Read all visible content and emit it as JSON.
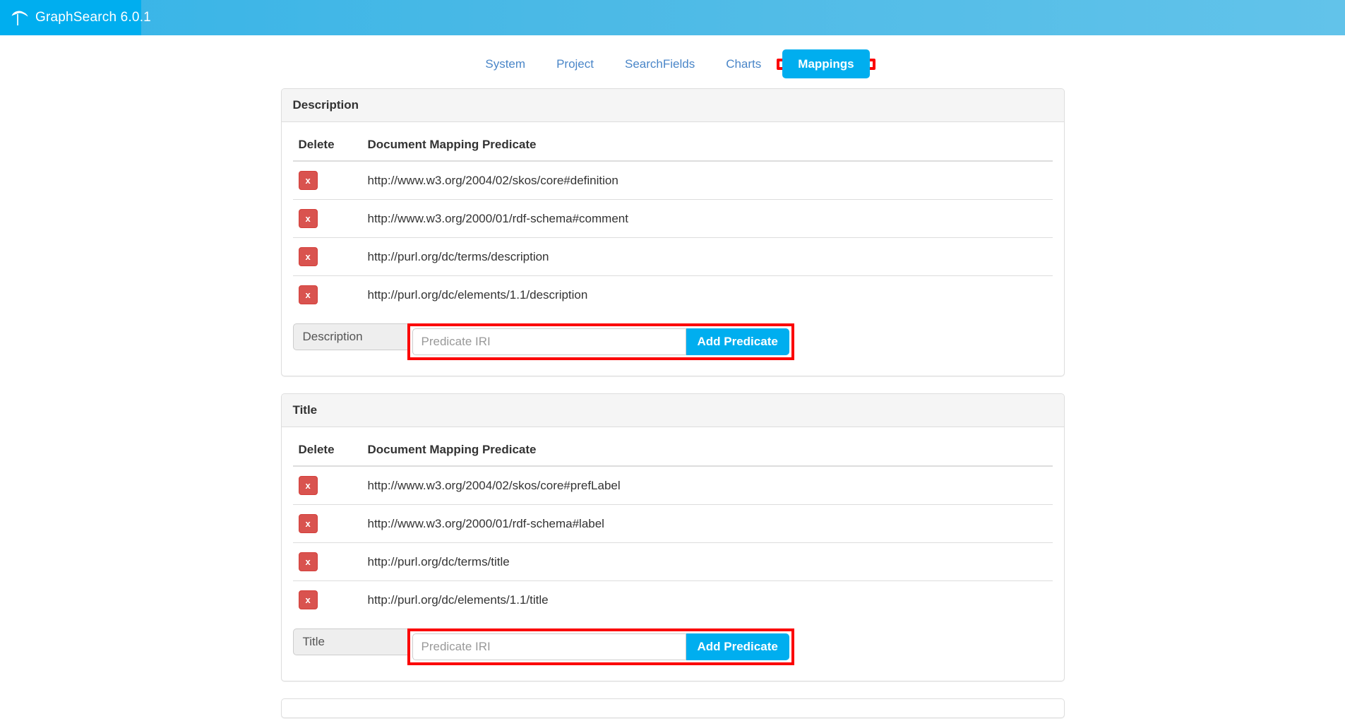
{
  "header": {
    "brand_title": "GraphSearch 6.0.1",
    "logo_icon": "umbrella-icon",
    "brand_color": "#00aeef",
    "bar_color": "#4ab9e6"
  },
  "nav": {
    "tabs": [
      {
        "label": "System",
        "active": false
      },
      {
        "label": "Project",
        "active": false
      },
      {
        "label": "SearchFields",
        "active": false
      },
      {
        "label": "Charts",
        "active": false
      },
      {
        "label": "Mappings",
        "active": true
      }
    ],
    "active_tab": "Mappings",
    "highlight_color": "#fb0000",
    "active_bg": "#00aeef",
    "link_color": "#4a86c8"
  },
  "panels": [
    {
      "heading": "Description",
      "columns": [
        "Delete",
        "Document Mapping Predicate"
      ],
      "delete_label": "x",
      "rows": [
        {
          "predicate": "http://www.w3.org/2004/02/skos/core#definition"
        },
        {
          "predicate": "http://www.w3.org/2000/01/rdf-schema#comment"
        },
        {
          "predicate": "http://purl.org/dc/terms/description"
        },
        {
          "predicate": "http://purl.org/dc/elements/1.1/description"
        }
      ],
      "add_form": {
        "addon_label": "Description",
        "input_value": "",
        "input_placeholder": "Predicate IRI",
        "button_label": "Add Predicate"
      }
    },
    {
      "heading": "Title",
      "columns": [
        "Delete",
        "Document Mapping Predicate"
      ],
      "delete_label": "x",
      "rows": [
        {
          "predicate": "http://www.w3.org/2004/02/skos/core#prefLabel"
        },
        {
          "predicate": "http://www.w3.org/2000/01/rdf-schema#label"
        },
        {
          "predicate": "http://purl.org/dc/terms/title"
        },
        {
          "predicate": "http://purl.org/dc/elements/1.1/title"
        }
      ],
      "add_form": {
        "addon_label": "Title",
        "input_value": "",
        "input_placeholder": "Predicate IRI",
        "button_label": "Add Predicate"
      }
    }
  ]
}
